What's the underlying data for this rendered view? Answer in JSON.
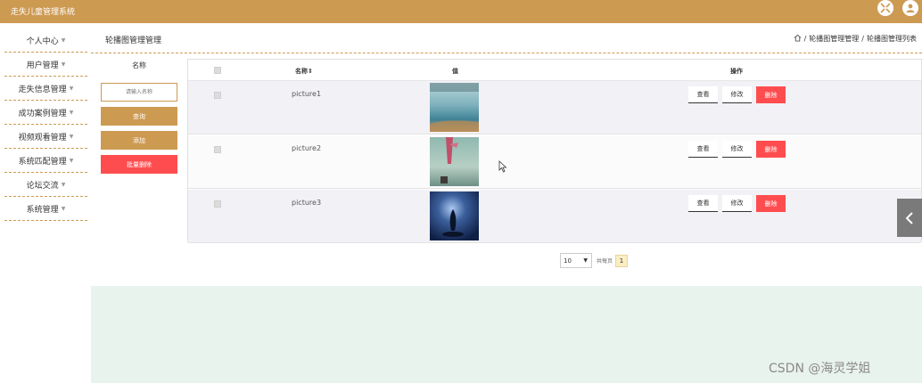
{
  "header": {
    "app_title": "走失儿童管理系统"
  },
  "sidebar": {
    "items": [
      {
        "label": "个人中心"
      },
      {
        "label": "用户管理"
      },
      {
        "label": "走失信息管理"
      },
      {
        "label": "成功案例管理"
      },
      {
        "label": "视频观看管理"
      },
      {
        "label": "系统匹配管理"
      },
      {
        "label": "论坛交流"
      },
      {
        "label": "系统管理"
      }
    ]
  },
  "page": {
    "title": "轮播图管理管理",
    "breadcrumb": {
      "sep": "/",
      "level1": "轮播图管理管理",
      "level2": "轮播图管理列表"
    }
  },
  "search": {
    "label": "名称",
    "placeholder": "请输入名称",
    "search_btn": "查询",
    "add_btn": "添加",
    "batch_delete_btn": "批量删除"
  },
  "table": {
    "columns": {
      "name": "名称⇕",
      "value": "值",
      "actions": "操作"
    },
    "rows": [
      {
        "name": "picture1"
      },
      {
        "name": "picture2"
      },
      {
        "name": "picture3"
      }
    ],
    "actions": {
      "view": "查看",
      "edit": "修改",
      "delete": "删除"
    }
  },
  "pagination": {
    "page_size": "10",
    "total_text": "共每页",
    "current_page": "1"
  },
  "watermark": "CSDN @海灵学姐",
  "colors": {
    "primary": "#cd9a52",
    "danger": "#ff4d4f",
    "footer_bg": "#e9f3ee"
  }
}
